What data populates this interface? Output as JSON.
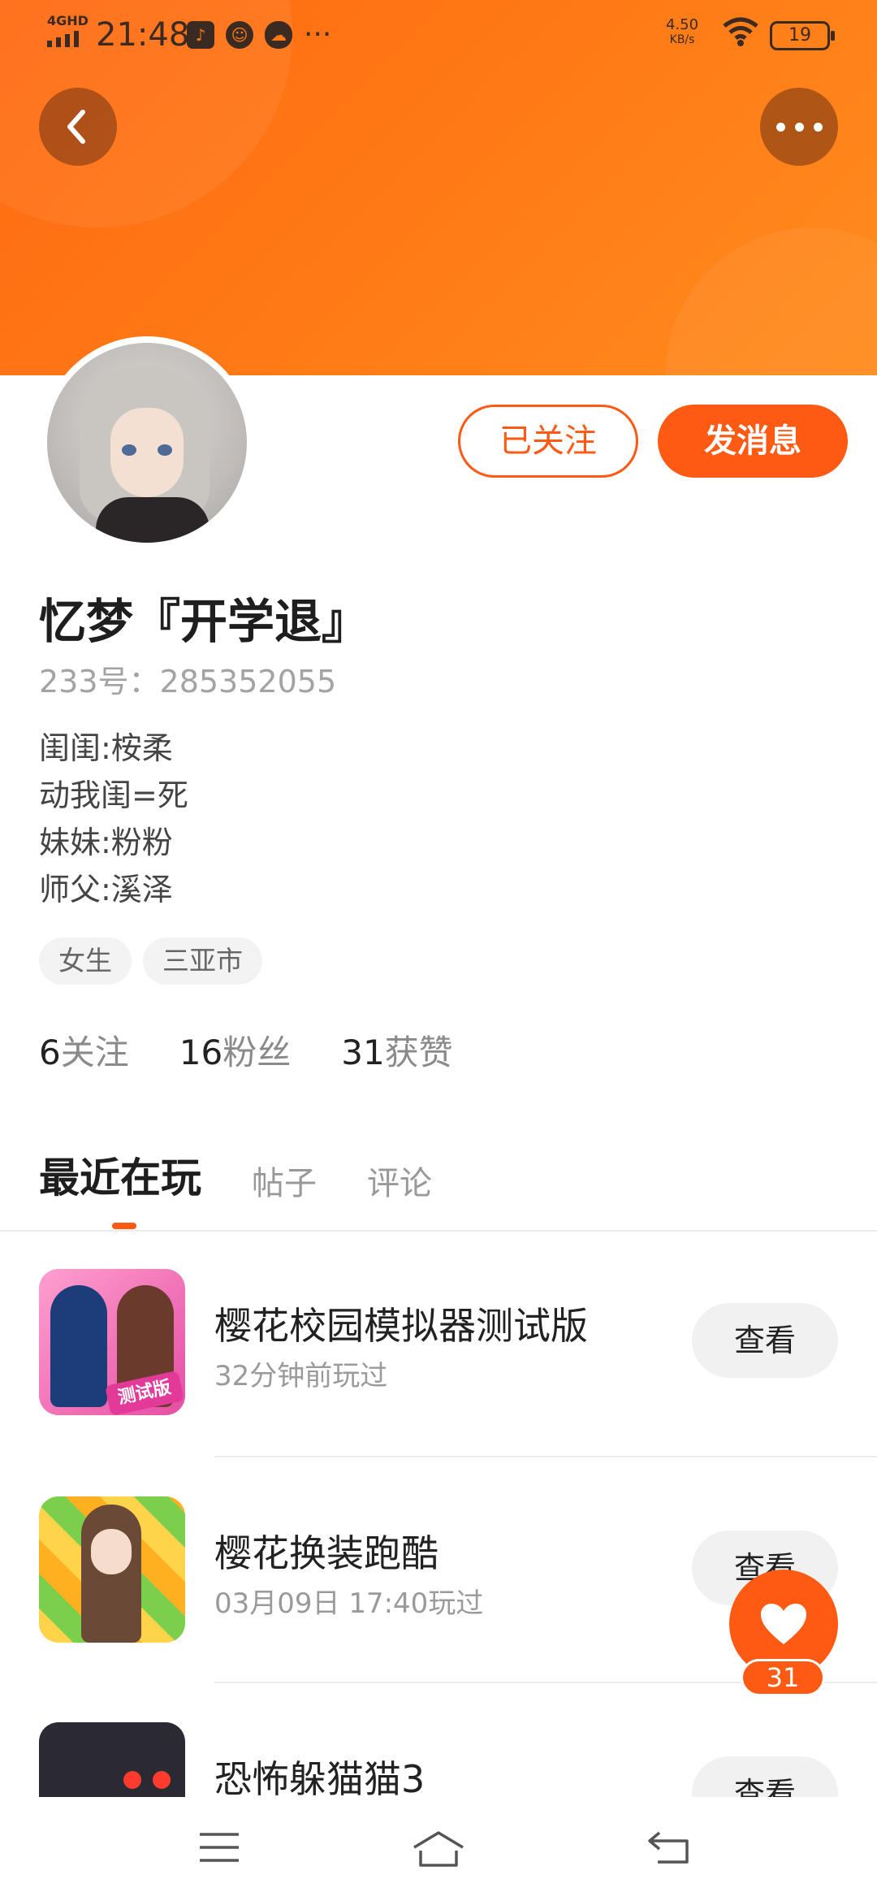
{
  "status_bar": {
    "network": "4GHD",
    "time": "21:48",
    "speed_value": "4.50",
    "speed_unit": "KB/s",
    "battery": "19"
  },
  "header": {
    "back_icon": "chevron-left-icon",
    "more_icon": "more-horizontal-icon",
    "gradient_start": "#ff6a12",
    "gradient_end": "#ff8c1e"
  },
  "profile": {
    "followed_label": "已关注",
    "message_label": "发消息",
    "name": "忆梦『开学退』",
    "id_text": "233号：285352055",
    "bio": [
      "闺闺:桉柔",
      "动我闺=死",
      "妹妹:粉粉",
      "师父:溪泽"
    ],
    "tags": [
      "女生",
      "三亚市"
    ],
    "stats": [
      {
        "num": "6",
        "label": "关注"
      },
      {
        "num": "16",
        "label": "粉丝"
      },
      {
        "num": "31",
        "label": "获赞"
      }
    ]
  },
  "tabs": [
    "最近在玩",
    "帖子",
    "评论"
  ],
  "games": [
    {
      "title": "樱花校园模拟器测试版",
      "time": "32分钟前玩过",
      "action": "查看",
      "icon_badge": "测试版"
    },
    {
      "title": "樱花换装跑酷",
      "time": "03月09日 17:40玩过",
      "action": "查看"
    },
    {
      "title": "恐怖躲猫猫3",
      "time": "",
      "action": "查看"
    }
  ],
  "fab": {
    "icon": "heart-icon",
    "count": "31"
  },
  "nav": {
    "menu_icon": "menu-icon",
    "home_icon": "home-icon",
    "back_icon": "back-icon"
  },
  "accent_color": "#ff5a14"
}
